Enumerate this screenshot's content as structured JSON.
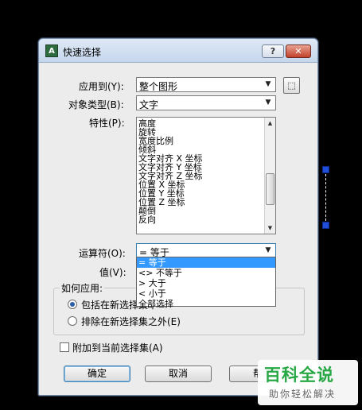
{
  "window": {
    "title": "快速选择",
    "app_icon": "autocad-icon",
    "help_glyph": "?",
    "close_glyph": "✕"
  },
  "labels": {
    "apply_to": "应用到(Y):",
    "object_type": "对象类型(B):",
    "properties": "特性(P):",
    "operator": "运算符(O):",
    "value": "值(V):"
  },
  "apply_to": {
    "value": "整个图形"
  },
  "object_type": {
    "value": "文字"
  },
  "properties": {
    "items": [
      "高度",
      "旋转",
      "宽度比例",
      "倾斜",
      "文字对齐 X 坐标",
      "文字对齐 Y 坐标",
      "文字对齐 Z 坐标",
      "位置 X 坐标",
      "位置 Y 坐标",
      "位置 Z 坐标",
      "颠倒",
      "反向"
    ]
  },
  "operator": {
    "value": "= 等于",
    "options": [
      "= 等于",
      "<> 不等于",
      "> 大于",
      "< 小于",
      "全部选择"
    ],
    "selected_index": 0
  },
  "how_to_apply": {
    "title": "如何应用:",
    "include": "包括在新选择集中",
    "exclude": "排除在新选择集之外(E)",
    "selected": "include"
  },
  "append": {
    "label": "附加到当前选择集(A)",
    "checked": false
  },
  "buttons": {
    "ok": "确定",
    "cancel": "取消",
    "help": "帮助"
  },
  "watermark": {
    "main": "百科全说",
    "sub": "助你轻松解决"
  },
  "colors": {
    "accent": "#3399ff",
    "grip": "#1f4fd8",
    "watermark": "#27a844"
  }
}
